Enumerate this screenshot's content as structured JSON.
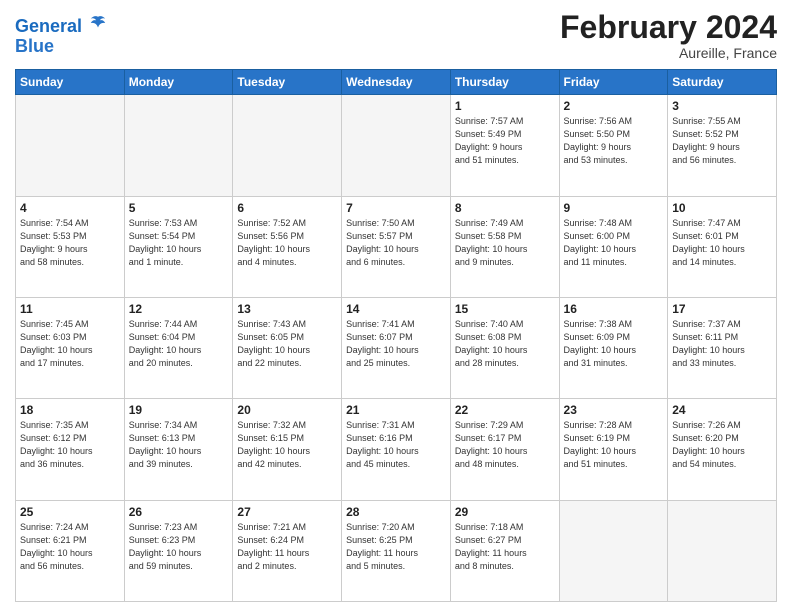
{
  "header": {
    "logo_line1": "General",
    "logo_line2": "Blue",
    "title": "February 2024",
    "subtitle": "Aureille, France"
  },
  "columns": [
    "Sunday",
    "Monday",
    "Tuesday",
    "Wednesday",
    "Thursday",
    "Friday",
    "Saturday"
  ],
  "weeks": [
    [
      {
        "day": "",
        "info": ""
      },
      {
        "day": "",
        "info": ""
      },
      {
        "day": "",
        "info": ""
      },
      {
        "day": "",
        "info": ""
      },
      {
        "day": "1",
        "info": "Sunrise: 7:57 AM\nSunset: 5:49 PM\nDaylight: 9 hours\nand 51 minutes."
      },
      {
        "day": "2",
        "info": "Sunrise: 7:56 AM\nSunset: 5:50 PM\nDaylight: 9 hours\nand 53 minutes."
      },
      {
        "day": "3",
        "info": "Sunrise: 7:55 AM\nSunset: 5:52 PM\nDaylight: 9 hours\nand 56 minutes."
      }
    ],
    [
      {
        "day": "4",
        "info": "Sunrise: 7:54 AM\nSunset: 5:53 PM\nDaylight: 9 hours\nand 58 minutes."
      },
      {
        "day": "5",
        "info": "Sunrise: 7:53 AM\nSunset: 5:54 PM\nDaylight: 10 hours\nand 1 minute."
      },
      {
        "day": "6",
        "info": "Sunrise: 7:52 AM\nSunset: 5:56 PM\nDaylight: 10 hours\nand 4 minutes."
      },
      {
        "day": "7",
        "info": "Sunrise: 7:50 AM\nSunset: 5:57 PM\nDaylight: 10 hours\nand 6 minutes."
      },
      {
        "day": "8",
        "info": "Sunrise: 7:49 AM\nSunset: 5:58 PM\nDaylight: 10 hours\nand 9 minutes."
      },
      {
        "day": "9",
        "info": "Sunrise: 7:48 AM\nSunset: 6:00 PM\nDaylight: 10 hours\nand 11 minutes."
      },
      {
        "day": "10",
        "info": "Sunrise: 7:47 AM\nSunset: 6:01 PM\nDaylight: 10 hours\nand 14 minutes."
      }
    ],
    [
      {
        "day": "11",
        "info": "Sunrise: 7:45 AM\nSunset: 6:03 PM\nDaylight: 10 hours\nand 17 minutes."
      },
      {
        "day": "12",
        "info": "Sunrise: 7:44 AM\nSunset: 6:04 PM\nDaylight: 10 hours\nand 20 minutes."
      },
      {
        "day": "13",
        "info": "Sunrise: 7:43 AM\nSunset: 6:05 PM\nDaylight: 10 hours\nand 22 minutes."
      },
      {
        "day": "14",
        "info": "Sunrise: 7:41 AM\nSunset: 6:07 PM\nDaylight: 10 hours\nand 25 minutes."
      },
      {
        "day": "15",
        "info": "Sunrise: 7:40 AM\nSunset: 6:08 PM\nDaylight: 10 hours\nand 28 minutes."
      },
      {
        "day": "16",
        "info": "Sunrise: 7:38 AM\nSunset: 6:09 PM\nDaylight: 10 hours\nand 31 minutes."
      },
      {
        "day": "17",
        "info": "Sunrise: 7:37 AM\nSunset: 6:11 PM\nDaylight: 10 hours\nand 33 minutes."
      }
    ],
    [
      {
        "day": "18",
        "info": "Sunrise: 7:35 AM\nSunset: 6:12 PM\nDaylight: 10 hours\nand 36 minutes."
      },
      {
        "day": "19",
        "info": "Sunrise: 7:34 AM\nSunset: 6:13 PM\nDaylight: 10 hours\nand 39 minutes."
      },
      {
        "day": "20",
        "info": "Sunrise: 7:32 AM\nSunset: 6:15 PM\nDaylight: 10 hours\nand 42 minutes."
      },
      {
        "day": "21",
        "info": "Sunrise: 7:31 AM\nSunset: 6:16 PM\nDaylight: 10 hours\nand 45 minutes."
      },
      {
        "day": "22",
        "info": "Sunrise: 7:29 AM\nSunset: 6:17 PM\nDaylight: 10 hours\nand 48 minutes."
      },
      {
        "day": "23",
        "info": "Sunrise: 7:28 AM\nSunset: 6:19 PM\nDaylight: 10 hours\nand 51 minutes."
      },
      {
        "day": "24",
        "info": "Sunrise: 7:26 AM\nSunset: 6:20 PM\nDaylight: 10 hours\nand 54 minutes."
      }
    ],
    [
      {
        "day": "25",
        "info": "Sunrise: 7:24 AM\nSunset: 6:21 PM\nDaylight: 10 hours\nand 56 minutes."
      },
      {
        "day": "26",
        "info": "Sunrise: 7:23 AM\nSunset: 6:23 PM\nDaylight: 10 hours\nand 59 minutes."
      },
      {
        "day": "27",
        "info": "Sunrise: 7:21 AM\nSunset: 6:24 PM\nDaylight: 11 hours\nand 2 minutes."
      },
      {
        "day": "28",
        "info": "Sunrise: 7:20 AM\nSunset: 6:25 PM\nDaylight: 11 hours\nand 5 minutes."
      },
      {
        "day": "29",
        "info": "Sunrise: 7:18 AM\nSunset: 6:27 PM\nDaylight: 11 hours\nand 8 minutes."
      },
      {
        "day": "",
        "info": ""
      },
      {
        "day": "",
        "info": ""
      }
    ]
  ]
}
